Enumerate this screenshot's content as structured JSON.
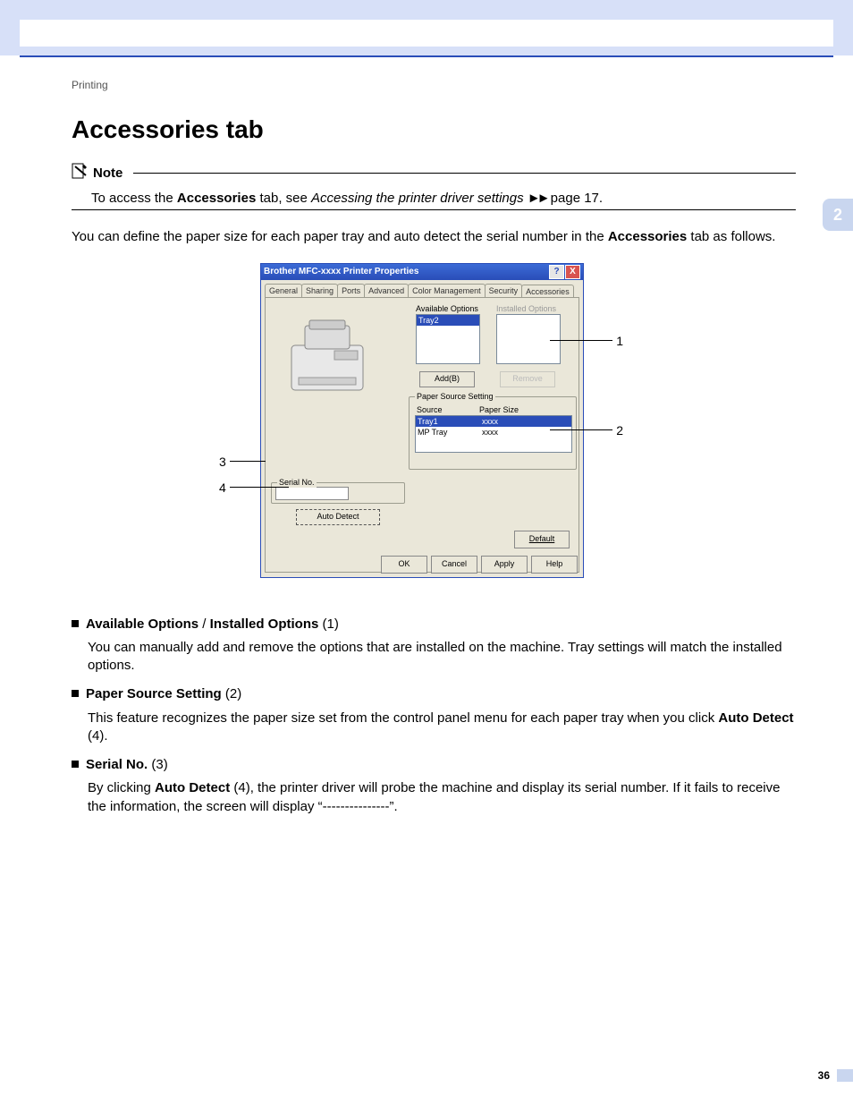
{
  "running_head": "Printing",
  "chapter_num": "2",
  "page_num": "36",
  "title": "Accessories tab",
  "note": {
    "label": "Note",
    "body_pre": "To access the ",
    "body_bold": "Accessories",
    "body_mid": " tab, see ",
    "body_italic": "Accessing the printer driver settings",
    "body_post": " page 17."
  },
  "intro_pre": "You can define the paper size for each paper tray and auto detect the serial number in the ",
  "intro_bold": "Accessories",
  "intro_post": " tab as follows.",
  "win": {
    "title": "Brother MFC-xxxx Printer Properties",
    "help": "?",
    "close": "X",
    "tabs": [
      "General",
      "Sharing",
      "Ports",
      "Advanced",
      "Color Management",
      "Security",
      "Accessories"
    ],
    "available_label": "Available Options",
    "installed_label": "Installed Options",
    "available_items": [
      "Tray2"
    ],
    "add_btn": "Add(B)",
    "remove_btn": "Remove",
    "pss_label": "Paper Source Setting",
    "pss_col1": "Source",
    "pss_col2": "Paper Size",
    "pss_rows": [
      {
        "src": "Tray1",
        "size": "xxxx"
      },
      {
        "src": "MP Tray",
        "size": "xxxx"
      }
    ],
    "serial_label": "Serial No.",
    "auto_detect": "Auto Detect",
    "default_btn": "Default",
    "ok": "OK",
    "cancel": "Cancel",
    "apply": "Apply",
    "help_btn": "Help"
  },
  "callouts": {
    "c1": "1",
    "c2": "2",
    "c3": "3",
    "c4": "4"
  },
  "items": [
    {
      "head_b1": "Available Options",
      "head_sep": " / ",
      "head_b2": "Installed Options",
      "head_num": " (1)",
      "body": "You can manually add and remove the options that are installed on the machine. Tray settings will match the installed options."
    },
    {
      "head_b1": "Paper Source Setting",
      "head_num": " (2)",
      "body_pre": "This feature recognizes the paper size set from the control panel menu for each paper tray when you click ",
      "body_bold": "Auto Detect",
      "body_post": " (4)."
    },
    {
      "head_b1": "Serial No.",
      "head_num": " (3)",
      "body_pre": "By clicking ",
      "body_bold": "Auto Detect",
      "body_post": " (4), the printer driver will probe the machine and display its serial number. If it fails to receive the information, the screen will display “---------------”."
    }
  ]
}
